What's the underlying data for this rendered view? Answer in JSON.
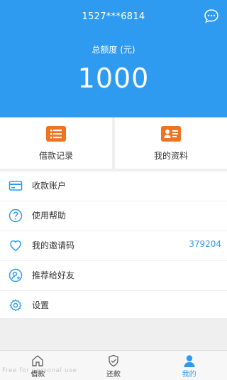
{
  "header": {
    "phone": "1527***6814",
    "total_label": "总额度 (元)",
    "total_amount": "1000"
  },
  "tiles": [
    {
      "label": "借款记录",
      "icon": "list-icon"
    },
    {
      "label": "我的资料",
      "icon": "id-card-icon"
    }
  ],
  "menu": [
    {
      "label": "收款账户",
      "icon": "card-icon",
      "value": ""
    },
    {
      "label": "使用帮助",
      "icon": "help-icon",
      "value": ""
    },
    {
      "label": "我的邀请码",
      "icon": "heart-icon",
      "value": "379204"
    },
    {
      "label": "推荐给好友",
      "icon": "share-user-icon",
      "value": ""
    },
    {
      "label": "设置",
      "icon": "gear-icon",
      "value": ""
    }
  ],
  "tabs": [
    {
      "label": "借款",
      "icon": "home-icon",
      "active": false
    },
    {
      "label": "还款",
      "icon": "shield-check-icon",
      "active": false
    },
    {
      "label": "我的",
      "icon": "user-icon",
      "active": true
    }
  ],
  "watermark": "Free for personal use",
  "colors": {
    "accent": "#2f9bf0",
    "tile_icon": "#f07320",
    "background": "#efefef"
  }
}
